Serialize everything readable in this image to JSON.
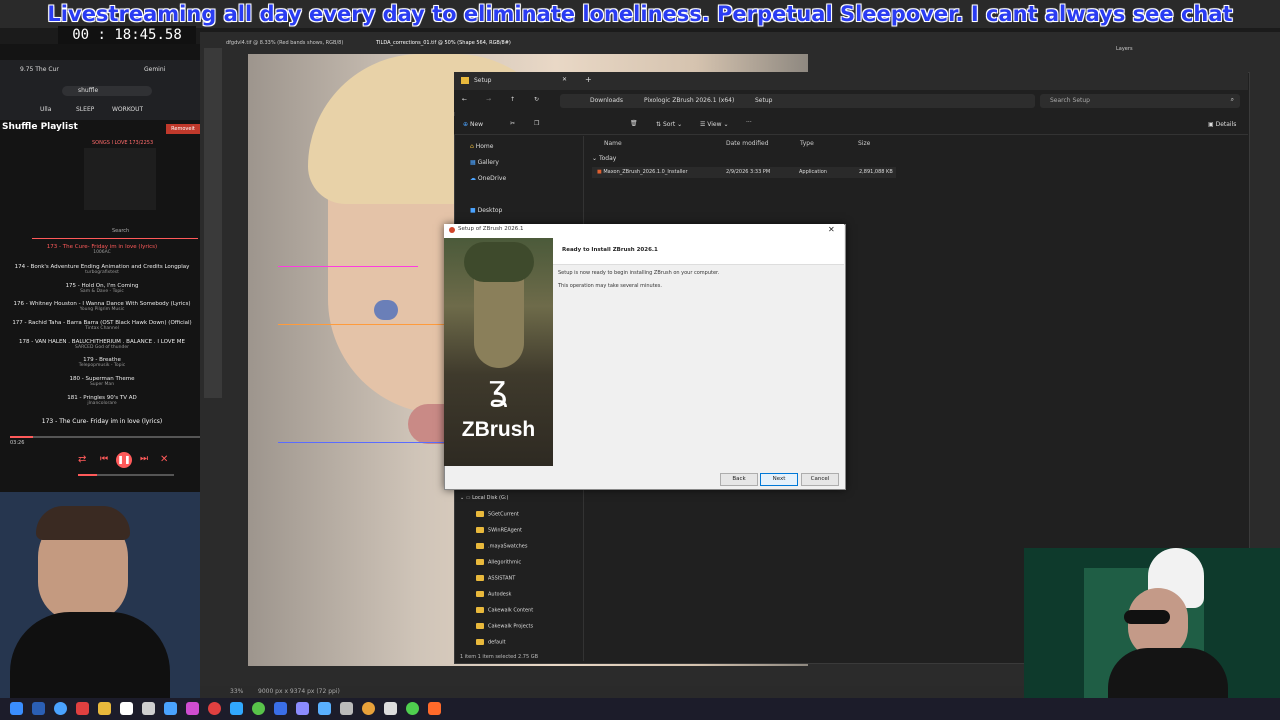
{
  "banner": {
    "text": "Livestreaming all day every day to eliminate loneliness. Perpetual Sleepover. I cant always see chat"
  },
  "timer": {
    "value": "00 : 18:45.58"
  },
  "browser": {
    "tab_label": "9.75 The Cur",
    "gemini_label": "Gemini",
    "bookmark_label": "shuffle",
    "bookmarks": [
      "Ulla",
      "SLEEP",
      "WORKOUT"
    ]
  },
  "playlist": {
    "title": "Shuffle Playlist",
    "button_label": "Removeit",
    "header_label": "SONGS I LOVE 173/2253",
    "search_label": "Search",
    "now_playing": "173 - The Cure- Friday im in love (lyrics)",
    "elapsed": "03:26",
    "tracks": [
      {
        "title": "173 - The Cure- Friday im in love (lyrics)",
        "artist": "1006AC",
        "active": true
      },
      {
        "title": "174 - Bonk's Adventure Ending Animation and Credits Longplay",
        "artist": "turbografixtest"
      },
      {
        "title": "175 - Hold On, I'm Coming",
        "artist": "Sam & Dave - Topic"
      },
      {
        "title": "176 - Whitney Houston - I Wanna Dance With Somebody (Lyrics)",
        "artist": "Young Pilgrim Music"
      },
      {
        "title": "177 - Rachid Taha - Barra Barra (OST Black Hawk Down) (Official)",
        "artist": "Tintax Channel"
      },
      {
        "title": "178 - VAN HALEN . BALUCHITHERIUM . BALANCE . I LOVE ME",
        "artist": "SARCED God of thunder"
      },
      {
        "title": "179 - Breathe",
        "artist": "Telepopmusik - Topic"
      },
      {
        "title": "180 - Superman Theme",
        "artist": "Super Man"
      },
      {
        "title": "181 - Pringles 90's TV AD",
        "artist": "jlnancolorare"
      }
    ]
  },
  "photoshop": {
    "tab1": "dfgdvl4.tif @ 8.33% (Red bands shows, RGB/8)",
    "tab2": "TILDA_corrections_01.tif @ 50% (Shape 564, RGB/8#)",
    "status": "9000 px x 9374 px (72 ppi)",
    "zoom": "33%",
    "layers_label": "Layers"
  },
  "explorer": {
    "window_title": "Setup",
    "breadcrumb": [
      "Downloads",
      "Pixologic ZBrush 2026.1 (x64)",
      "Setup"
    ],
    "search_placeholder": "Search Setup",
    "commands": {
      "new": "New",
      "sort": "Sort",
      "view": "View",
      "details": "Details"
    },
    "columns": {
      "name": "Name",
      "date": "Date modified",
      "type": "Type",
      "size": "Size"
    },
    "group_label": "Today",
    "file": {
      "name": "Maxon_ZBrush_2026.1.0_Installer",
      "date": "2/9/2026 3:33 PM",
      "type": "Application",
      "size": "2,891,088 KB"
    },
    "nav_top": [
      "Home",
      "Gallery",
      "OneDrive",
      "Desktop"
    ],
    "drive": "Local Disk (G:)",
    "folders": [
      "5GetCurrent",
      "5WinREAgent",
      ".mayaSwatches",
      "Allegorithmic",
      "ASSISTANT",
      "Autodesk",
      "Cakewalk Content",
      "Cakewalk Projects",
      "default"
    ],
    "status": "1 item   1 item selected  2.75 GB"
  },
  "dialog": {
    "title": "Setup of ZBrush 2026.1",
    "heading": "Ready to Install ZBrush 2026.1",
    "body1": "Setup is now ready to begin installing ZBrush on your computer.",
    "body2": "This operation may take several minutes.",
    "logo_text": "ZBrush",
    "buttons": {
      "back": "Back",
      "next": "Next",
      "cancel": "Cancel"
    }
  },
  "colors": {
    "banner_text": "#2a3cf2",
    "accent_red": "#ff5a5a",
    "folder": "#e9b93c"
  }
}
